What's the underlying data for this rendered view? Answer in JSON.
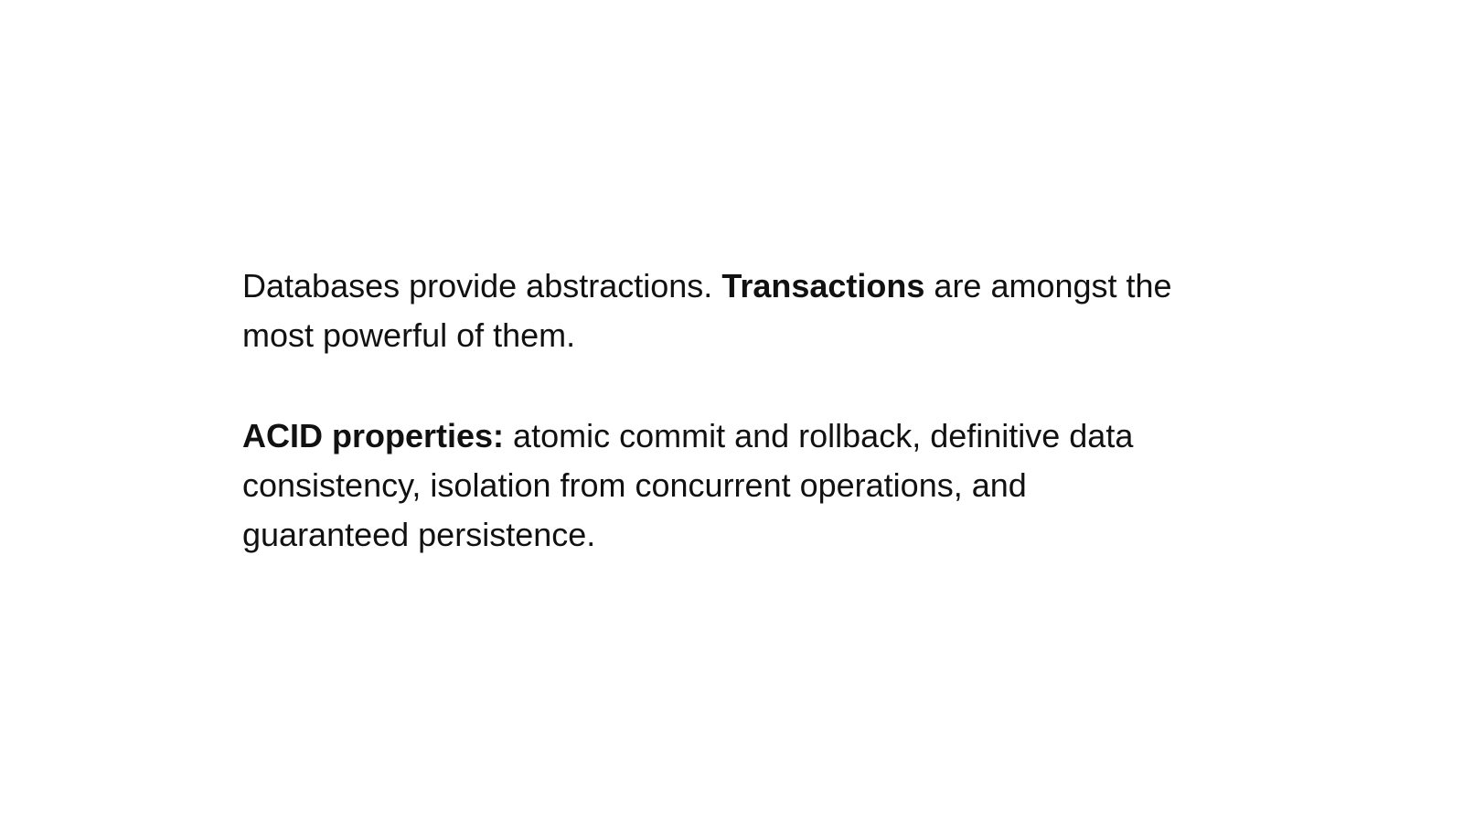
{
  "slide": {
    "paragraph_1": {
      "intro": "Databases provide abstractions.",
      "emphasis": "Transactions",
      "tail_line_1": "are amongst the",
      "tail_line_2": "most powerful of them."
    },
    "paragraph_2": {
      "emphasis": "ACID properties:",
      "line_1": "atomic commit and rollback, definitive data",
      "line_2": "consistency, isolation from concurrent operations, and",
      "line_3": "guaranteed persistence."
    }
  }
}
